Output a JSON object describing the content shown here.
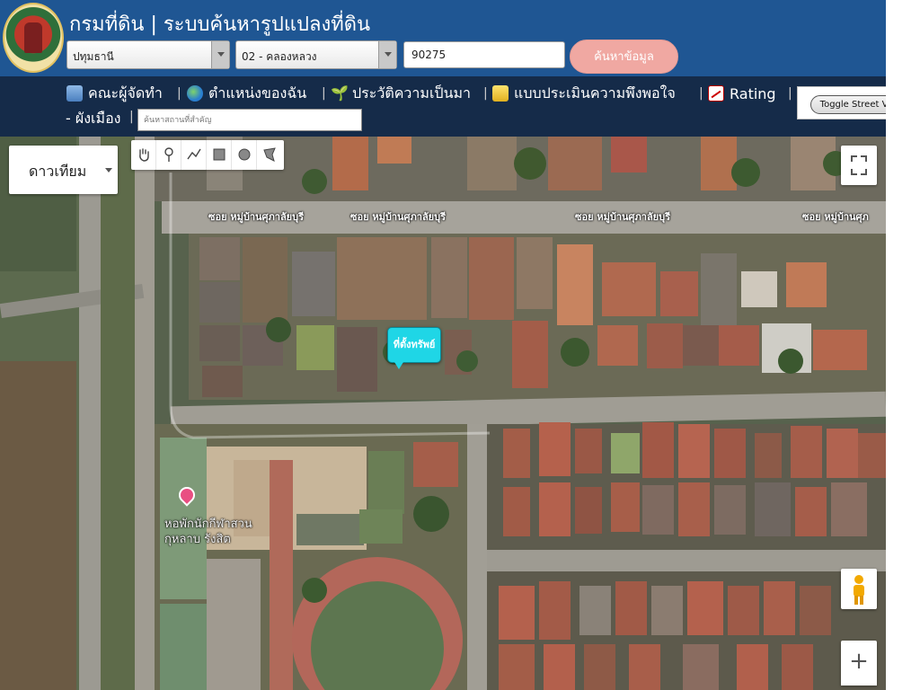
{
  "header": {
    "title": "กรมที่ดิน | ระบบค้นหารูปแปลงที่ดิน",
    "province_value": "ปทุมธานี",
    "district_value": "02 - คลองหลวง",
    "parcel_value": "90275",
    "search_label": "ค้นหาข้อมูล"
  },
  "menu": {
    "items": [
      {
        "label": "คณะผู้จัดทำ",
        "icon": "team-icon"
      },
      {
        "label": "ตำแหน่งของฉัน",
        "icon": "globe-icon"
      },
      {
        "label": "ประวัติความเป็นมา",
        "icon": "sprout-icon"
      },
      {
        "label": "แบบประเมินความพึงพอใจ",
        "icon": "form-icon"
      },
      {
        "label": "Rating",
        "icon": "chart-icon"
      }
    ],
    "separator": "|",
    "city_plan_label": "- ผังเมือง",
    "place_search_placeholder": "ค้นหาสถานที่สำคัญ",
    "toggle_street_view_label": "Toggle Street View"
  },
  "map": {
    "map_type_label": "ดาวเทียม",
    "road_labels": [
      "ซอย หมู่บ้านศุภาลัยบุรี",
      "ซอย หมู่บ้านศุภาลัยบุรี",
      "ซอย หมู่บ้านศุภาลัยบุรี",
      "ซอย หมู่บ้านศุภ"
    ],
    "marker_label": "ที่ตั้งทรัพย์",
    "poi_label_line1": "หอพักนักกีฬาสวน",
    "poi_label_line2": "กุหลาบ รังสิต",
    "zoom_in_label": "+",
    "draw_tools": [
      "hand-icon",
      "marker-icon",
      "polyline-icon",
      "rectangle-icon",
      "circle-icon",
      "polygon-icon"
    ]
  },
  "colors": {
    "header_bg": "#1f5693",
    "menubar_bg": "#152b49",
    "search_button": "#f0a8a2",
    "marker": "#1fd6e6",
    "poi_pin": "#e94f82"
  }
}
